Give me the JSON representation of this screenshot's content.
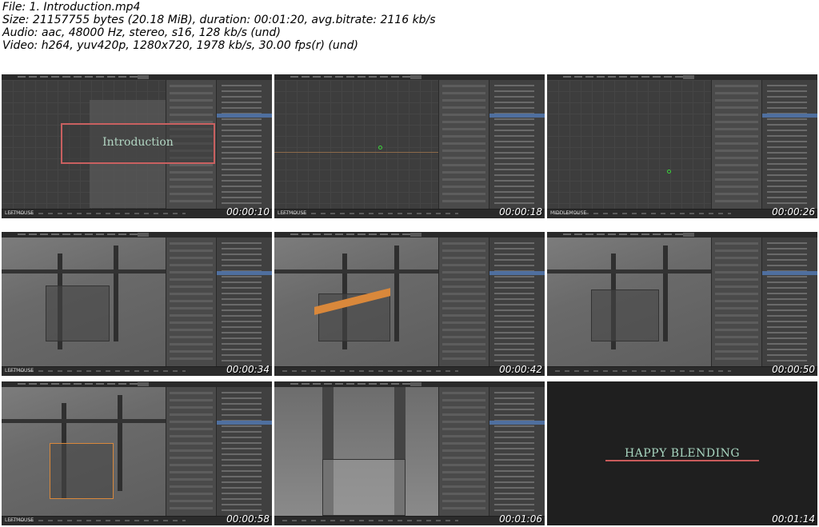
{
  "header": {
    "file": "File: 1. Introduction.mp4",
    "size": "Size: 21157755 bytes (20.18 MiB), duration: 00:01:20, avg.bitrate: 2116 kb/s",
    "audio": "Audio: aac, 48000 Hz, stereo, s16, 128 kb/s (und)",
    "video": "Video: h264, yuv420p, 1280x720, 1978 kb/s, 30.00 fps(r) (und)"
  },
  "thumbnails": [
    {
      "time": "00:00:10",
      "overlay": "Introduction",
      "label": "LEFTMOUSE"
    },
    {
      "time": "00:00:18",
      "label": "LEFTMOUSE"
    },
    {
      "time": "00:00:26",
      "label": "MIDDLEMOUSE"
    },
    {
      "time": "00:00:34",
      "label": "LEFTMOUSE"
    },
    {
      "time": "00:00:42"
    },
    {
      "time": "00:00:50"
    },
    {
      "time": "00:00:58",
      "label": "LEFTMOUSE"
    },
    {
      "time": "00:01:06"
    },
    {
      "time": "00:01:14",
      "overlay": "HAPPY BLENDING"
    }
  ]
}
